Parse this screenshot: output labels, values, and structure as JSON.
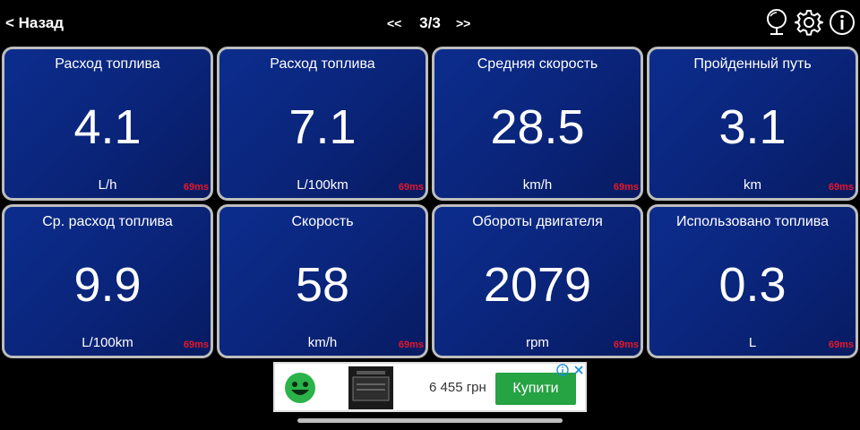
{
  "nav": {
    "back_label": "< Назад",
    "prev_label": "<<",
    "page_label": "3/3",
    "next_label": ">>"
  },
  "icons": [
    "mirror-icon",
    "gear-icon",
    "info-icon"
  ],
  "tiles": [
    {
      "title": "Расход топлива",
      "value": "4.1",
      "unit": "L/h",
      "latency": "69ms"
    },
    {
      "title": "Расход топлива",
      "value": "7.1",
      "unit": "L/100km",
      "latency": "69ms"
    },
    {
      "title": "Средняя скорость",
      "value": "28.5",
      "unit": "km/h",
      "latency": "69ms"
    },
    {
      "title": "Пройденный путь",
      "value": "3.1",
      "unit": "km",
      "latency": "69ms"
    },
    {
      "title": "Ср. расход топлива",
      "value": "9.9",
      "unit": "L/100km",
      "latency": "69ms"
    },
    {
      "title": "Скорость",
      "value": "58",
      "unit": "km/h",
      "latency": "69ms"
    },
    {
      "title": "Обороты двигателя",
      "value": "2079",
      "unit": "rpm",
      "latency": "69ms"
    },
    {
      "title": "Использовано топлива",
      "value": "0.3",
      "unit": "L",
      "latency": "69ms"
    }
  ],
  "ad": {
    "price": "6 455 грн",
    "button_label": "Купити"
  },
  "colors": {
    "tile_bg": "#0a2479",
    "tile_border": "#bdbdbd",
    "latency": "#e8162a",
    "ad_button": "#26a343"
  }
}
